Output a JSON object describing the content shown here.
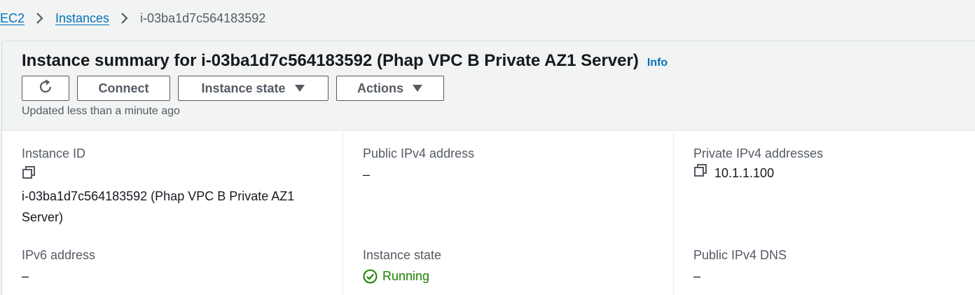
{
  "breadcrumb": {
    "items": [
      "EC2",
      "Instances"
    ],
    "current": "i-03ba1d7c564183592"
  },
  "header": {
    "title": "Instance summary for i-03ba1d7c564183592 (Phap VPC B Private AZ1 Server)",
    "info_label": "Info",
    "connect_label": "Connect",
    "instance_state_label": "Instance state",
    "actions_label": "Actions",
    "updated_text": "Updated less than a minute ago"
  },
  "details": {
    "instance_id": {
      "label": "Instance ID",
      "value_line1": "i-03ba1d7c564183592 (Phap VPC B Private AZ1",
      "value_line2": "Server)"
    },
    "public_ipv4": {
      "label": "Public IPv4 address",
      "value": "–"
    },
    "private_ipv4": {
      "label": "Private IPv4 addresses",
      "value": "10.1.1.100"
    },
    "ipv6": {
      "label": "IPv6 address",
      "value": "–"
    },
    "instance_state": {
      "label": "Instance state",
      "value": "Running"
    },
    "public_dns": {
      "label": "Public IPv4 DNS",
      "value": "–"
    }
  },
  "colors": {
    "link": "#0073bb",
    "running": "#1d8102",
    "button_border": "#545b64"
  },
  "icons": [
    "chevron-right-icon",
    "refresh-icon",
    "caret-down-icon",
    "copy-icon",
    "check-circle-icon"
  ]
}
